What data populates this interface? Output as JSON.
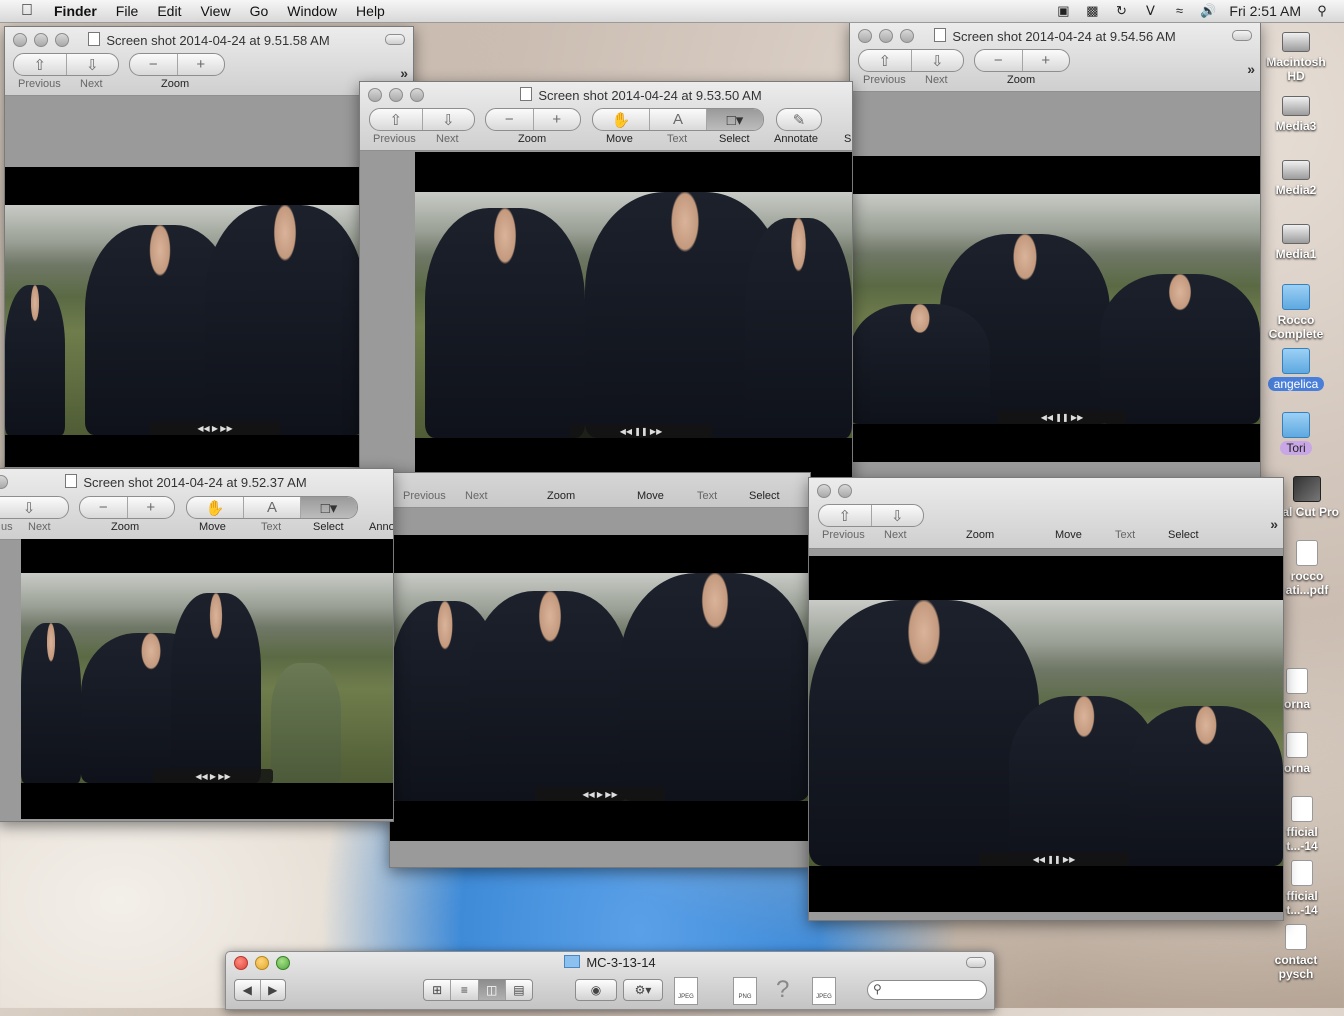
{
  "menubar": {
    "apple": "",
    "app": "Finder",
    "items": [
      "File",
      "Edit",
      "View",
      "Go",
      "Window",
      "Help"
    ],
    "clock": "Fri 2:51 AM"
  },
  "toolbar": {
    "previous": "Previous",
    "next": "Next",
    "zoom": "Zoom",
    "move": "Move",
    "text": "Text",
    "select": "Select",
    "annotate": "Annotate",
    "annotate_clipped": "Anno",
    "annotate_clipped2": "A",
    "share_clipped": "S",
    "previous_clipped": "us",
    "overflow": "»"
  },
  "windows": [
    {
      "id": "w1",
      "title": "Screen shot 2014-04-24 at 9.51.58 AM"
    },
    {
      "id": "w2",
      "title": "Screen shot 2014-04-24 at 9.53.50 AM"
    },
    {
      "id": "w3",
      "title": "Screen shot 2014-04-24 at 9.54.56 AM"
    },
    {
      "id": "w4",
      "title": "Screen shot 2014-04-24 at 9.52.37 AM"
    },
    {
      "id": "w5",
      "title": ""
    },
    {
      "id": "w6",
      "title": ""
    }
  ],
  "desktop": [
    {
      "label": "Macintosh HD",
      "icon": "hard-disk-icon"
    },
    {
      "label": "Media3",
      "icon": "hard-disk-icon"
    },
    {
      "label": "Media2",
      "icon": "hard-disk-icon"
    },
    {
      "label": "Media1",
      "icon": "hard-disk-icon"
    },
    {
      "label": "Rocco Complete",
      "icon": "folder-icon"
    },
    {
      "label": "angelica",
      "icon": "folder-icon",
      "tag_color": "#4a7fd9"
    },
    {
      "label": "Tori",
      "icon": "folder-icon",
      "tag_color": "#c9a6e6"
    },
    {
      "label": "nal Cut Pro",
      "icon": "final-cut-pro-icon"
    },
    {
      "label": "rocco ati...pdf",
      "icon": "pdf-file-icon"
    },
    {
      "label": "orna",
      "icon": "pdf-file-icon"
    },
    {
      "label": "orna",
      "icon": "pdf-file-icon"
    },
    {
      "label": "fficial t...-14",
      "icon": "document-file-icon"
    },
    {
      "label": "fficial t...-14",
      "icon": "document-file-icon"
    },
    {
      "label": "contact pysch",
      "icon": "pdf-file-icon"
    }
  ],
  "finder": {
    "title": "MC-3-13-14",
    "thumbs": [
      "JPEG",
      "PNG",
      "?",
      "JPEG"
    ],
    "search_placeholder": ""
  },
  "colors": {
    "accent_blue": "#4a7fd9",
    "tag_lavender": "#c9a6e6"
  }
}
